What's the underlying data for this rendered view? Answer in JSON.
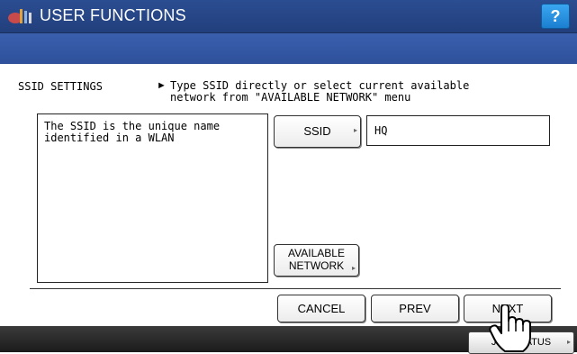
{
  "header": {
    "title": "USER FUNCTIONS",
    "help_label": "?"
  },
  "section": {
    "label": "SSID SETTINGS",
    "instruction_arrow": "►",
    "instruction": "Type SSID directly or select current available\nnetwork from \"AVAILABLE NETWORK\" menu"
  },
  "description": "The SSID is the unique name\nidentified in a WLAN",
  "ssid": {
    "button_label": "SSID",
    "value": "HQ"
  },
  "available_network_label": "AVAILABLE\nNETWORK",
  "buttons": {
    "cancel": "CANCEL",
    "prev": "PREV",
    "next": "NEXT"
  },
  "footer": {
    "job_status_label": "JOB STATUS"
  },
  "icons": {
    "app": "user-functions-icon",
    "corner": "corner-triangle-icon",
    "pointer": "hand-pointer-icon"
  },
  "colors": {
    "header_bg": "#2b4d91",
    "subheader_bg": "#3a5fad",
    "help_accent": "#1b7fd0",
    "footer_bg": "#2a2a2a"
  }
}
